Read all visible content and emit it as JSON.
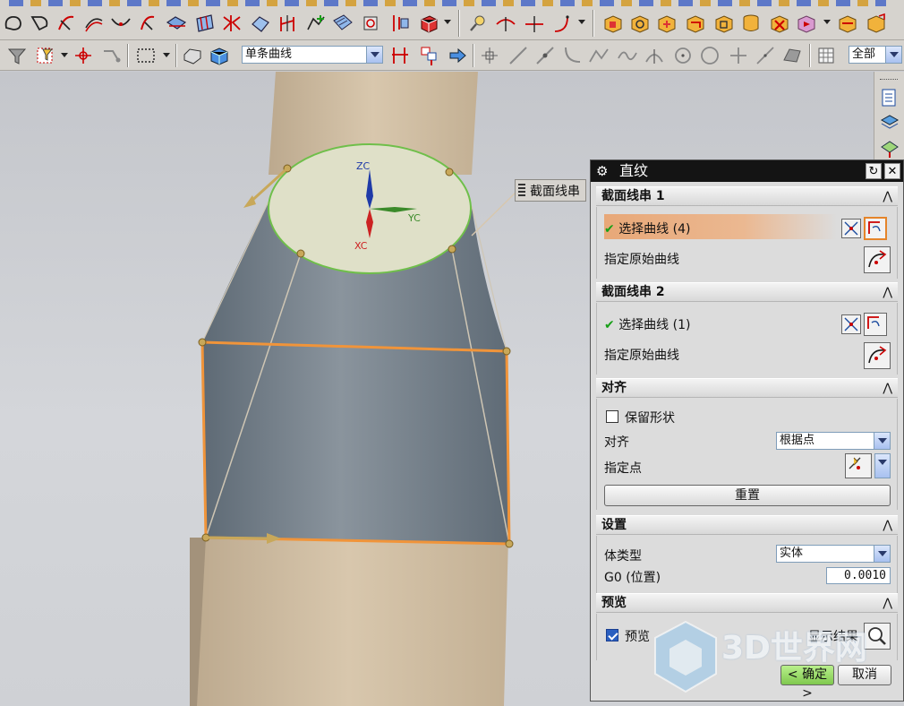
{
  "app": {
    "toolbar": {
      "filter_label": "单条曲线",
      "layer_label": "全部"
    }
  },
  "viewport": {
    "callout_label": "截面线串",
    "axes": {
      "zc": "ZC",
      "yc": "YC",
      "xc": "XC"
    }
  },
  "dialog": {
    "title": "直纹",
    "sections": {
      "section1": {
        "title": "截面线串 1",
        "select_label": "选择曲线 (4)",
        "origin_label": "指定原始曲线"
      },
      "section2": {
        "title": "截面线串 2",
        "select_label": "选择曲线 (1)",
        "origin_label": "指定原始曲线"
      },
      "align": {
        "title": "对齐",
        "keep_shape_label": "保留形状",
        "align_label": "对齐",
        "align_value": "根据点",
        "point_label": "指定点",
        "reset_label": "重置"
      },
      "settings": {
        "title": "设置",
        "body_type_label": "体类型",
        "body_type_value": "实体",
        "g0_label": "G0 (位置)",
        "g0_value": "0.0010"
      },
      "preview": {
        "title": "预览",
        "preview_label": "预览",
        "show_result_label": "显示结果"
      }
    },
    "ok_label": "< 确定 >",
    "cancel_label": "取消"
  },
  "watermark": {
    "text": "3D世界网"
  },
  "colors": {
    "section_fill": "#dcdcdc",
    "selected_row": "#e8a878",
    "face": "#6f7b86",
    "edge": "#f0943a",
    "pipe": "#cdb99c"
  }
}
